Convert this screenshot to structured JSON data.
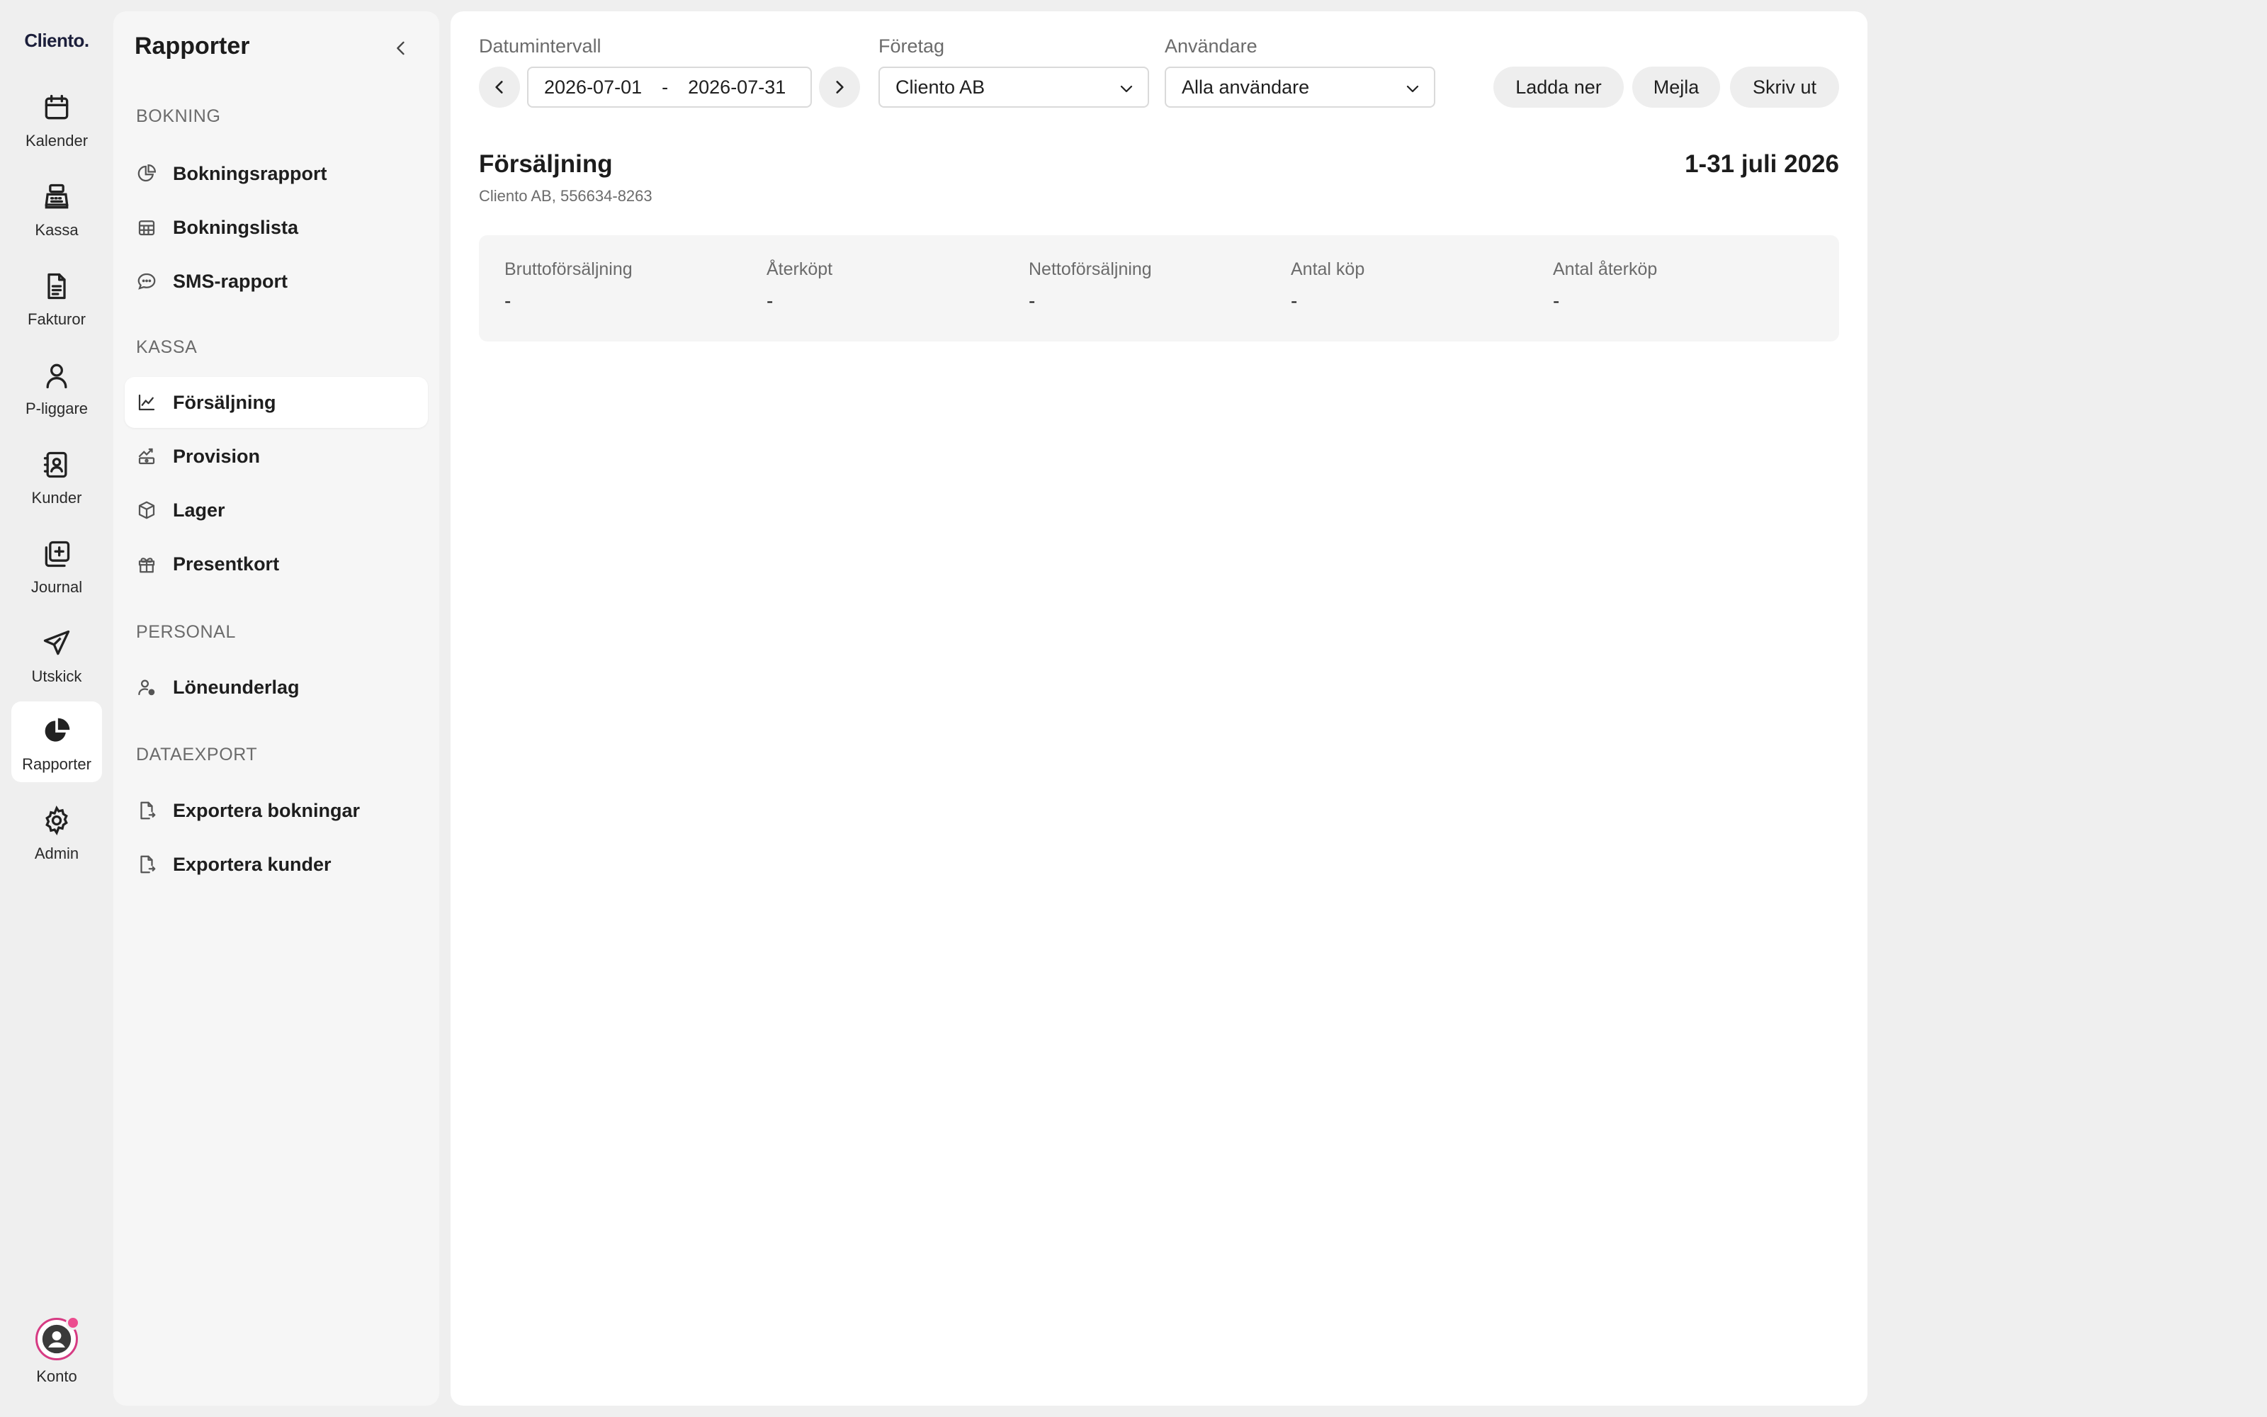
{
  "brand": {
    "logo_text": "Cliento."
  },
  "rail": {
    "items": [
      {
        "label": "Kalender",
        "icon": "calendar-icon"
      },
      {
        "label": "Kassa",
        "icon": "cash-register-icon"
      },
      {
        "label": "Fakturor",
        "icon": "invoice-icon"
      },
      {
        "label": "P-liggare",
        "icon": "person-icon"
      },
      {
        "label": "Kunder",
        "icon": "contact-book-icon"
      },
      {
        "label": "Journal",
        "icon": "journal-add-icon"
      },
      {
        "label": "Utskick",
        "icon": "send-icon"
      },
      {
        "label": "Rapporter",
        "icon": "pie-chart-icon",
        "active": true
      },
      {
        "label": "Admin",
        "icon": "gear-icon"
      }
    ],
    "account_label": "Konto",
    "notification_color": "#ec4d8f"
  },
  "sidebar": {
    "title": "Rapporter",
    "sections": [
      {
        "heading": "BOKNING",
        "items": [
          "Bokningsrapport",
          "Bokningslista",
          "SMS-rapport"
        ]
      },
      {
        "heading": "KASSA",
        "items": [
          "Försäljning",
          "Provision",
          "Lager",
          "Presentkort"
        ],
        "active": "Försäljning"
      },
      {
        "heading": "PERSONAL",
        "items": [
          "Löneunderlag"
        ]
      },
      {
        "heading": "DATAEXPORT",
        "items": [
          "Exportera bokningar",
          "Exportera kunder"
        ]
      }
    ]
  },
  "filters": {
    "date_label": "Datumintervall",
    "date_from": "2026-07-01",
    "date_separator": "-",
    "date_to": "2026-07-31",
    "company_label": "Företag",
    "company_value": "Cliento AB",
    "user_label": "Användare",
    "user_value": "Alla användare"
  },
  "actions": {
    "download": "Ladda ner",
    "email": "Mejla",
    "print": "Skriv ut"
  },
  "report": {
    "title": "Försäljning",
    "subtitle": "Cliento AB, 556634-8263",
    "period": "1-31 juli 2026",
    "stats": [
      {
        "label": "Bruttoförsäljning",
        "value": "-"
      },
      {
        "label": "Återköpt",
        "value": "-"
      },
      {
        "label": "Nettoförsäljning",
        "value": "-"
      },
      {
        "label": "Antal köp",
        "value": "-"
      },
      {
        "label": "Antal återköp",
        "value": "-"
      }
    ]
  }
}
